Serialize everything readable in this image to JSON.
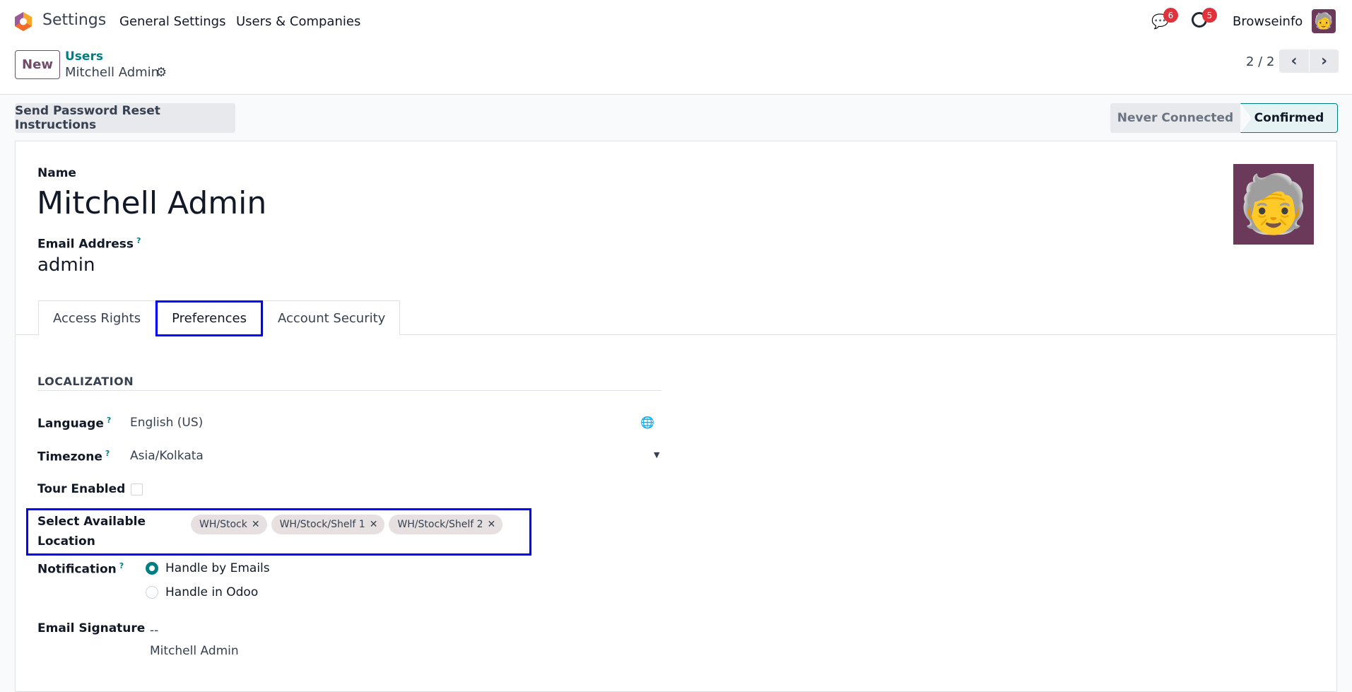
{
  "navbar": {
    "app": "Settings",
    "menus": [
      "General Settings",
      "Users & Companies"
    ],
    "messages_count": "6",
    "activities_count": "5",
    "company": "Browseinfo"
  },
  "control_panel": {
    "new_label": "New",
    "breadcrumb_parent": "Users",
    "breadcrumb_current": "Mitchell Admin",
    "pager": "2 / 2"
  },
  "actions": {
    "reset_password": "Send Password Reset Instructions"
  },
  "status": {
    "stages": [
      "Never Connected",
      "Confirmed"
    ],
    "active": "Confirmed"
  },
  "form": {
    "name_label": "Name",
    "name": "Mitchell Admin",
    "email_label": "Email Address",
    "email_help": "?",
    "email": "admin",
    "tabs": [
      "Access Rights",
      "Preferences",
      "Account Security"
    ],
    "active_tab": "Preferences",
    "section": "LOCALIZATION",
    "language_label": "Language",
    "language": "English (US)",
    "timezone_label": "Timezone",
    "timezone": "Asia/Kolkata",
    "tour_label": "Tour Enabled",
    "location_label_1": "Select Available",
    "location_label_2": "Location",
    "locations": [
      "WH/Stock",
      "WH/Stock/Shelf 1",
      "WH/Stock/Shelf 2"
    ],
    "notification_label": "Notification",
    "notification_options": [
      "Handle by Emails",
      "Handle in Odoo"
    ],
    "signature_label": "Email Signature",
    "signature_line1": "--",
    "signature_line2": "Mitchell Admin"
  },
  "colors": {
    "accent": "#017e84",
    "highlight": "#0000ff",
    "brand": "#714b67"
  }
}
